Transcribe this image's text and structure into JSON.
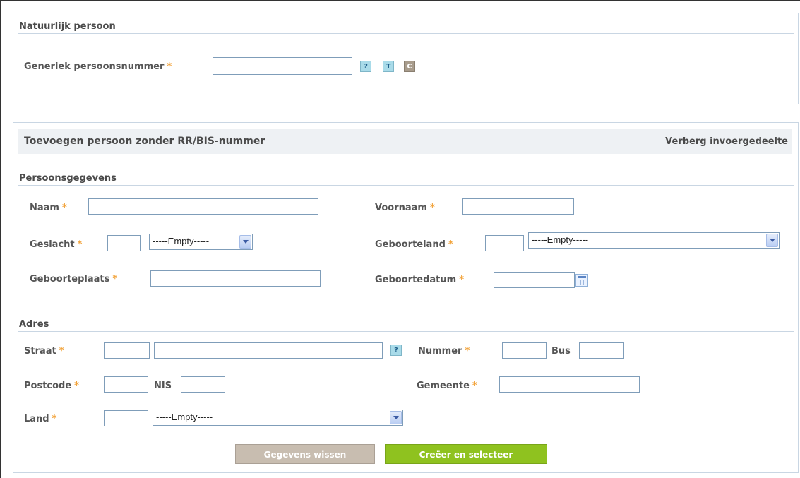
{
  "natural_person": {
    "heading": "Natuurlijk persoon",
    "generic_number_label": "Generiek persoonsnummer",
    "generic_number_value": "",
    "required_mark": "*",
    "help_btn": "?",
    "t_btn": "T",
    "c_btn": "C"
  },
  "add_person": {
    "title": "Toevoegen persoon zonder RR/BIS-nummer",
    "hide_link": "Verberg invoergedeelte"
  },
  "personal": {
    "heading": "Persoonsgegevens",
    "naam_label": "Naam",
    "voornaam_label": "Voornaam",
    "geslacht_label": "Geslacht",
    "geslacht_select": "-----Empty-----",
    "geboorteland_label": "Geboorteland",
    "geboorteland_select": "-----Empty-----",
    "geboorteplaats_label": "Geboorteplaats",
    "geboortedatum_label": "Geboortedatum"
  },
  "address": {
    "heading": "Adres",
    "straat_label": "Straat",
    "help_btn": "?",
    "nummer_label": "Nummer",
    "bus_label": "Bus",
    "postcode_label": "Postcode",
    "nis_label": "NIS",
    "gemeente_label": "Gemeente",
    "land_label": "Land",
    "land_select": "-----Empty-----"
  },
  "actions": {
    "clear_label": "Gegevens wissen",
    "create_label": "Creëer en selecteer"
  },
  "colors": {
    "required": "#f2a33a",
    "create_button": "#8fc21f",
    "clear_button": "#c8bdb0",
    "border": "#c9d6e3"
  }
}
